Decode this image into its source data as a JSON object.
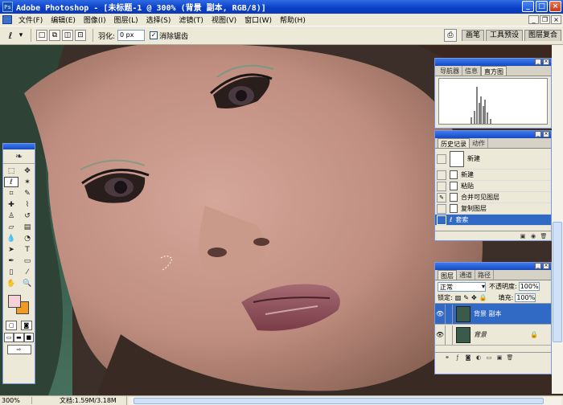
{
  "window": {
    "title": "Adobe Photoshop - [未标题-1 @ 300% (背景 副本, RGB/8)]",
    "buttons": [
      "_",
      "□",
      "×"
    ]
  },
  "menu": {
    "items": [
      "文件(F)",
      "编辑(E)",
      "图像(I)",
      "图层(L)",
      "选择(S)",
      "滤镜(T)",
      "视图(V)",
      "窗口(W)",
      "帮助(H)"
    ]
  },
  "options": {
    "feather_label": "羽化:",
    "feather_value": "0 px",
    "antialias_label": "消除锯齿",
    "antialias_checked": true,
    "palette_tabs": [
      "画笔",
      "工具预设",
      "图层复合"
    ]
  },
  "navigator": {
    "tabs": [
      "导航器",
      "信息",
      "直方图"
    ],
    "active_tab": 2
  },
  "history": {
    "tabs": [
      "历史记录",
      "动作"
    ],
    "snapshot_label": "新建",
    "items": [
      {
        "label": "新建",
        "selected": false
      },
      {
        "label": "粘贴",
        "selected": false
      },
      {
        "label": "合并可见图层",
        "selected": false
      },
      {
        "label": "复制图层",
        "selected": false
      },
      {
        "label": "套索",
        "selected": true
      }
    ]
  },
  "layers": {
    "tabs": [
      "图层",
      "通道",
      "路径"
    ],
    "blend_mode": "正常",
    "opacity_label": "不透明度:",
    "opacity_value": "100%",
    "lock_label": "锁定:",
    "fill_label": "填充:",
    "fill_value": "100%",
    "items": [
      {
        "name": "背景 副本",
        "selected": true
      },
      {
        "name": "背景",
        "selected": false
      }
    ]
  },
  "toolbox": {
    "foreground_color": "#F4D2D8",
    "background_color": "#F19B22"
  },
  "status": {
    "zoom": "300%",
    "doc_info": "文档:1.59M/3.18M"
  }
}
